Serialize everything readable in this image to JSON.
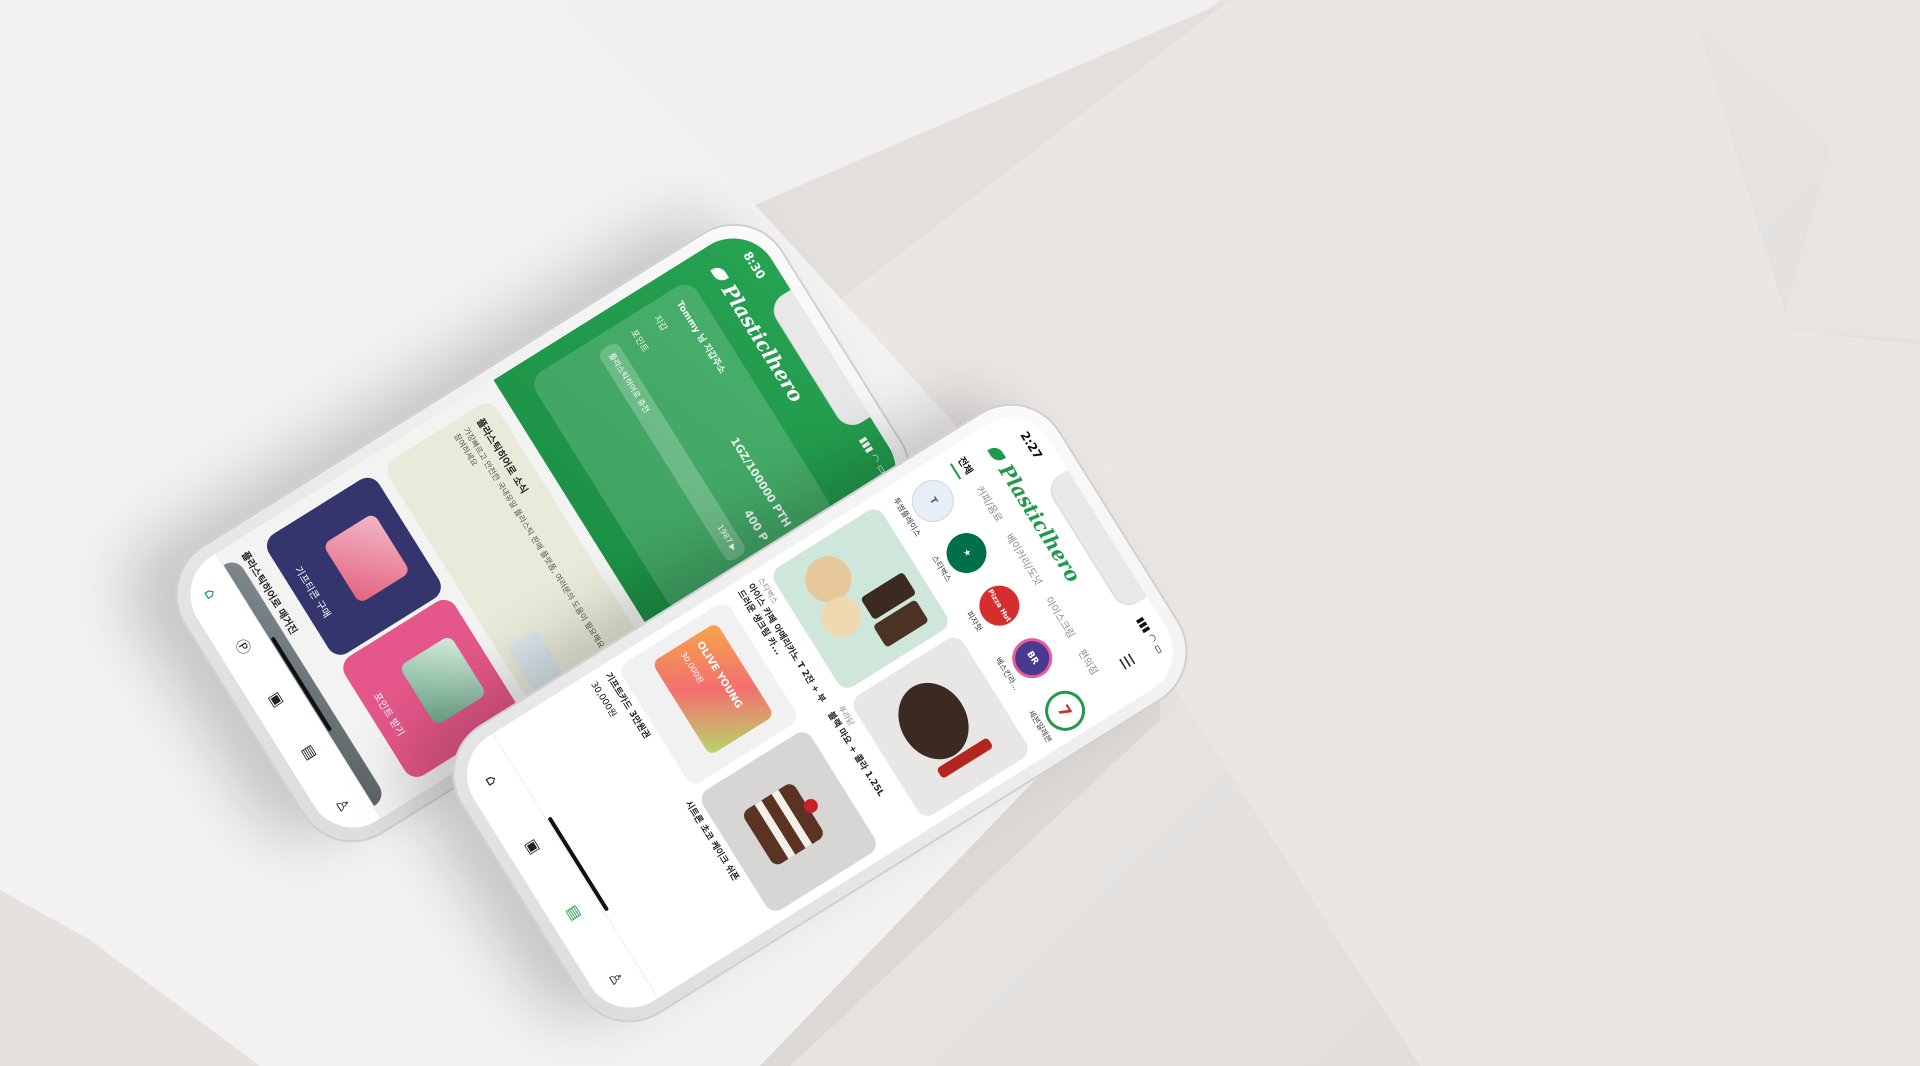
{
  "phone1": {
    "time": "8:30",
    "logo": "Plasticlhero",
    "wallet": {
      "user": "Tommy 님 지갑주소",
      "label1": "지갑",
      "amount1": "1GZ/100000 PTH",
      "label2": "포인트",
      "amount2": "400 P",
      "button": "플라스틱히어로 충전",
      "button_right": "1987 ▶"
    },
    "news": {
      "title": "플라스틱히어로 소식",
      "text": "가장빠르고 안전한 국내유일 플라스틱 판매 플랫폼, 여러분의 도움이 필요해요 참여하세요"
    },
    "tiles": {
      "gift": "기프티콘 구매",
      "point": "포인트 받기"
    },
    "magazine": "플라스틱히어로 매거진",
    "tabbar": {
      "home": "home-icon",
      "point": "point-icon",
      "wallet": "wallet-icon",
      "shop": "shop-icon",
      "profile": "profile-icon"
    }
  },
  "phone2": {
    "time": "2:27",
    "logo": "Plasticlhero",
    "categories": [
      "전체",
      "커피/음료",
      "베이커리/도넛",
      "아이스크림",
      "편의점"
    ],
    "brands": [
      {
        "name": "투썸플레이스",
        "color": "#e8eef5",
        "text_color": "#3a5d8f",
        "mark": "T"
      },
      {
        "name": "스타벅스",
        "color": "#00704a",
        "text_color": "#ffffff",
        "mark": "★"
      },
      {
        "name": "피자헛",
        "color": "#d62e2e",
        "text_color": "#ffffff",
        "mark": "Pizza Hut"
      },
      {
        "name": "베스킨라...",
        "color": "#4a3a8f",
        "text_color": "#ffffff",
        "mark": "BR"
      },
      {
        "name": "세븐일레븐",
        "color": "#ffffff",
        "text_color": "#1f9a4a",
        "mark": "7"
      }
    ],
    "products": [
      {
        "brand": "스타벅스",
        "name": "아이스 카페 아메리카노 T 2잔 + 부드러운 생크림 카...",
        "price": ""
      },
      {
        "brand": "푸라닭",
        "name": "블랙 마요 + 콜라 1.25L",
        "price": ""
      },
      {
        "brand": "",
        "name": "기프트카드 3만원권",
        "price": "30,000원"
      },
      {
        "brand": "",
        "name": "시트론 초코 케이크 쉬폰",
        "price": ""
      }
    ],
    "gift_card": {
      "brand": "OLIVE YOUNG",
      "amount": "30,000원"
    },
    "tabbar": {
      "home": "home-icon",
      "wallet": "wallet-icon",
      "shop": "shop-icon",
      "profile": "profile-icon"
    }
  }
}
